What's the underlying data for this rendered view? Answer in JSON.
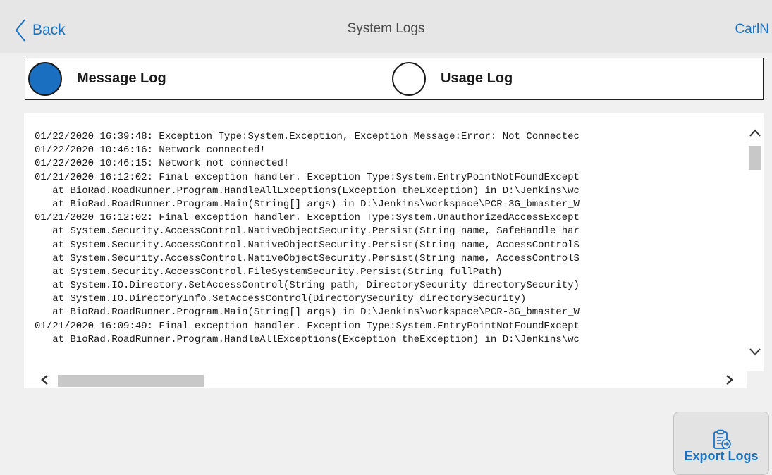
{
  "header": {
    "back_label": "Back",
    "title": "System Logs",
    "user": "CarlN"
  },
  "log_type": {
    "options": [
      {
        "label": "Message Log",
        "selected": true
      },
      {
        "label": "Usage Log",
        "selected": false
      }
    ]
  },
  "log": {
    "lines": [
      "01/22/2020 16:39:48: Exception Type:System.Exception, Exception Message:Error: Not Connectec",
      "01/22/2020 10:46:16: Network connected!",
      "01/22/2020 10:46:15: Network not connected!",
      "01/21/2020 16:12:02: Final exception handler. Exception Type:System.EntryPointNotFoundExcept",
      "   at BioRad.RoadRunner.Program.HandleAllExceptions(Exception theException) in D:\\Jenkins\\wc",
      "   at BioRad.RoadRunner.Program.Main(String[] args) in D:\\Jenkins\\workspace\\PCR-3G_bmaster_W",
      "01/21/2020 16:12:02: Final exception handler. Exception Type:System.UnauthorizedAccessExcept",
      "   at System.Security.AccessControl.NativeObjectSecurity.Persist(String name, SafeHandle har",
      "   at System.Security.AccessControl.NativeObjectSecurity.Persist(String name, AccessControlS",
      "   at System.Security.AccessControl.NativeObjectSecurity.Persist(String name, AccessControlS",
      "   at System.Security.AccessControl.FileSystemSecurity.Persist(String fullPath)",
      "   at System.IO.Directory.SetAccessControl(String path, DirectorySecurity directorySecurity)",
      "   at System.IO.DirectoryInfo.SetAccessControl(DirectorySecurity directorySecurity)",
      "   at BioRad.RoadRunner.Program.Main(String[] args) in D:\\Jenkins\\workspace\\PCR-3G_bmaster_W",
      "01/21/2020 16:09:49: Final exception handler. Exception Type:System.EntryPointNotFoundExcept",
      "   at BioRad.RoadRunner.Program.HandleAllExceptions(Exception theException) in D:\\Jenkins\\wc"
    ]
  },
  "export": {
    "label": "Export Logs"
  },
  "colors": {
    "accent": "#1a72c5",
    "radio_selected": "#1a6fc0",
    "header_bg": "#e6e6e6",
    "page_bg": "#f0f0f0"
  },
  "icons": {
    "back": "chevron-left-icon",
    "export": "clipboard-export-icon",
    "scroll_up": "chevron-up-icon",
    "scroll_down": "chevron-down-icon",
    "scroll_left": "chevron-left-icon",
    "scroll_right": "chevron-right-icon"
  }
}
